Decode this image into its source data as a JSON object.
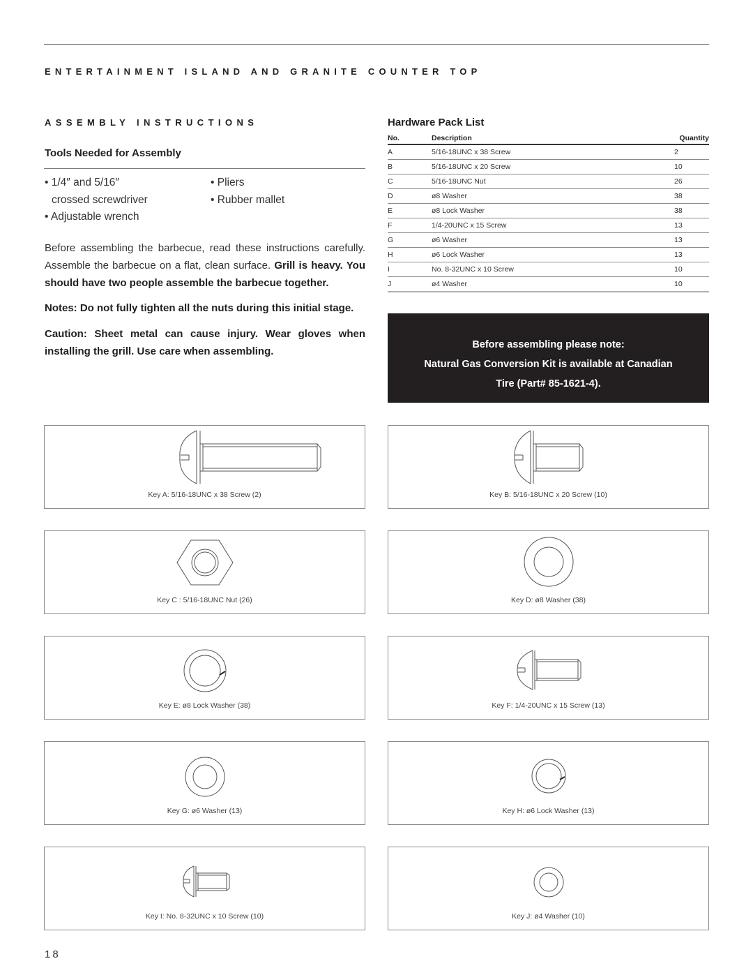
{
  "document": {
    "title": "ENTERTAINMENT ISLAND AND GRANITE COUNTER TOP",
    "section_title": "ASSEMBLY INSTRUCTIONS",
    "page_number": "18"
  },
  "tools": {
    "heading": "Tools Needed for Assembly",
    "items": [
      "• 1/4″ and 5/16″",
      "crossed screwdriver",
      "• Adjustable wrench",
      "• Pliers",
      "• Rubber mallet"
    ]
  },
  "instructions": {
    "intro_regular": "Before assembling the barbecue, read these instructions carefully. Assemble the barbecue on a flat, clean surface. ",
    "intro_bold": "Grill is heavy. You should have two people assemble the barbecue together.",
    "notes": "Notes: Do not fully tighten all the nuts during this initial stage.",
    "caution": "Caution: Sheet metal can cause injury. Wear gloves when installing the grill. Use care when assembling."
  },
  "hardware": {
    "title": "Hardware Pack List",
    "columns": [
      "No.",
      "Description",
      "Quantity"
    ],
    "rows": [
      {
        "no": "A",
        "description": "5/16-18UNC x 38 Screw",
        "quantity": "2"
      },
      {
        "no": "B",
        "description": "5/16-18UNC x 20 Screw",
        "quantity": "10"
      },
      {
        "no": "C",
        "description": "5/16-18UNC Nut",
        "quantity": "26"
      },
      {
        "no": "D",
        "description": "ø8 Washer",
        "quantity": "38"
      },
      {
        "no": "E",
        "description": "ø8 Lock Washer",
        "quantity": "38"
      },
      {
        "no": "F",
        "description": "1/4-20UNC x 15 Screw",
        "quantity": "13"
      },
      {
        "no": "G",
        "description": "ø6 Washer",
        "quantity": "13"
      },
      {
        "no": "H",
        "description": "ø6 Lock Washer",
        "quantity": "13"
      },
      {
        "no": "I",
        "description": "No. 8-32UNC x 10 Screw",
        "quantity": "10"
      },
      {
        "no": "J",
        "description": "ø4 Washer",
        "quantity": "10"
      }
    ]
  },
  "notice": {
    "line1": "Before assembling please note:",
    "line2": "Natural Gas Conversion Kit is available at Canadian",
    "line3": "Tire (Part# 85-1621-4)."
  },
  "keys": [
    {
      "label": "Key A: 5/16-18UNC x 38 Screw (2)",
      "icon": "long-screw-icon"
    },
    {
      "label": "Key B: 5/16-18UNC x 20 Screw (10)",
      "icon": "screw-icon"
    },
    {
      "label": "Key C : 5/16-18UNC Nut (26)",
      "icon": "hex-nut-icon"
    },
    {
      "label": "Key D: ø8 Washer (38)",
      "icon": "washer-icon"
    },
    {
      "label": "Key E: ø8 Lock Washer (38)",
      "icon": "lock-washer-icon"
    },
    {
      "label": "Key F: 1/4-20UNC x 15 Screw (13)",
      "icon": "screw-icon"
    },
    {
      "label": "Key G: ø6 Washer (13)",
      "icon": "washer-icon"
    },
    {
      "label": "Key H: ø6 Lock Washer (13)",
      "icon": "lock-washer-icon"
    },
    {
      "label": "Key I: No. 8-32UNC x 10 Screw (10)",
      "icon": "small-screw-icon"
    },
    {
      "label": "Key J: ø4 Washer (10)",
      "icon": "washer-icon"
    }
  ]
}
